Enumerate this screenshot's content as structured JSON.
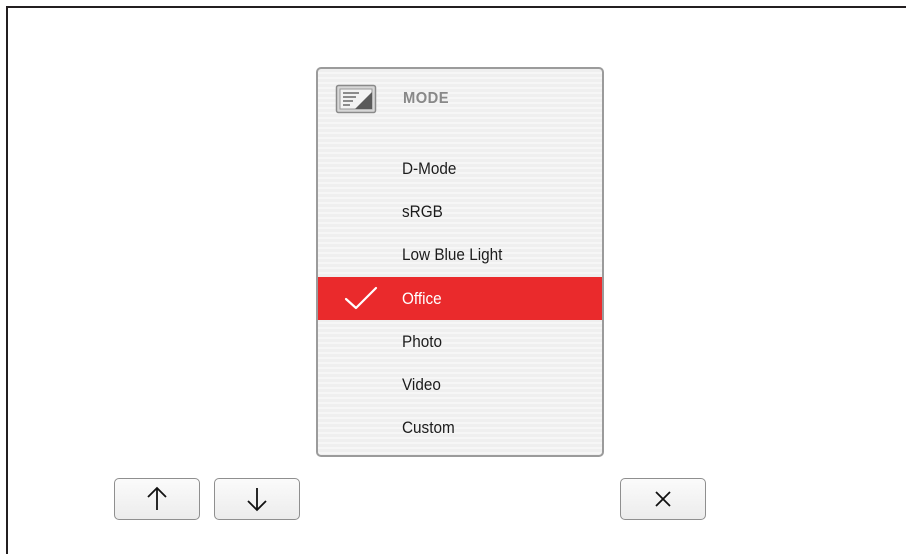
{
  "osd": {
    "title": "MODE",
    "icon": "picture-mode-icon",
    "selected_index": 3,
    "items": [
      {
        "label": "D-Mode"
      },
      {
        "label": "sRGB"
      },
      {
        "label": "Low Blue Light"
      },
      {
        "label": "Office"
      },
      {
        "label": "Photo"
      },
      {
        "label": "Video"
      },
      {
        "label": "Custom"
      }
    ]
  },
  "buttons": {
    "up": {
      "icon": "arrow-up-icon"
    },
    "down": {
      "icon": "arrow-down-icon"
    },
    "close": {
      "icon": "close-icon"
    }
  },
  "colors": {
    "selected_bg": "#ea2a2c",
    "panel_border": "#9b9b9b",
    "title_gray": "#888888"
  }
}
